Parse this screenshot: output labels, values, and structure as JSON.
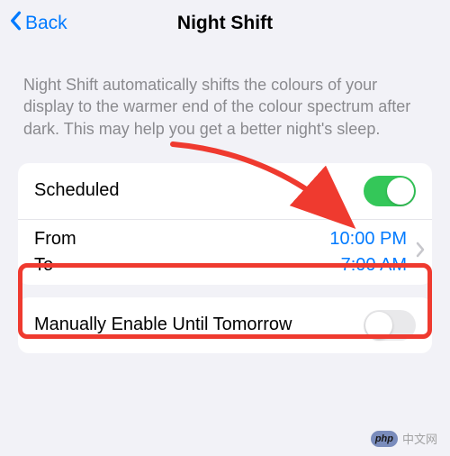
{
  "nav": {
    "back_label": "Back",
    "title": "Night Shift"
  },
  "description": "Night Shift automatically shifts the colours of your display to the warmer end of the colour spectrum after dark. This may help you get a better night's sleep.",
  "scheduled": {
    "label": "Scheduled",
    "enabled": true
  },
  "schedule": {
    "from_label": "From",
    "to_label": "To",
    "from_time": "10:00 PM",
    "to_time": "7:00 AM"
  },
  "manual": {
    "label": "Manually Enable Until Tomorrow",
    "enabled": false
  },
  "watermark": {
    "badge": "php",
    "text": "中文网"
  }
}
